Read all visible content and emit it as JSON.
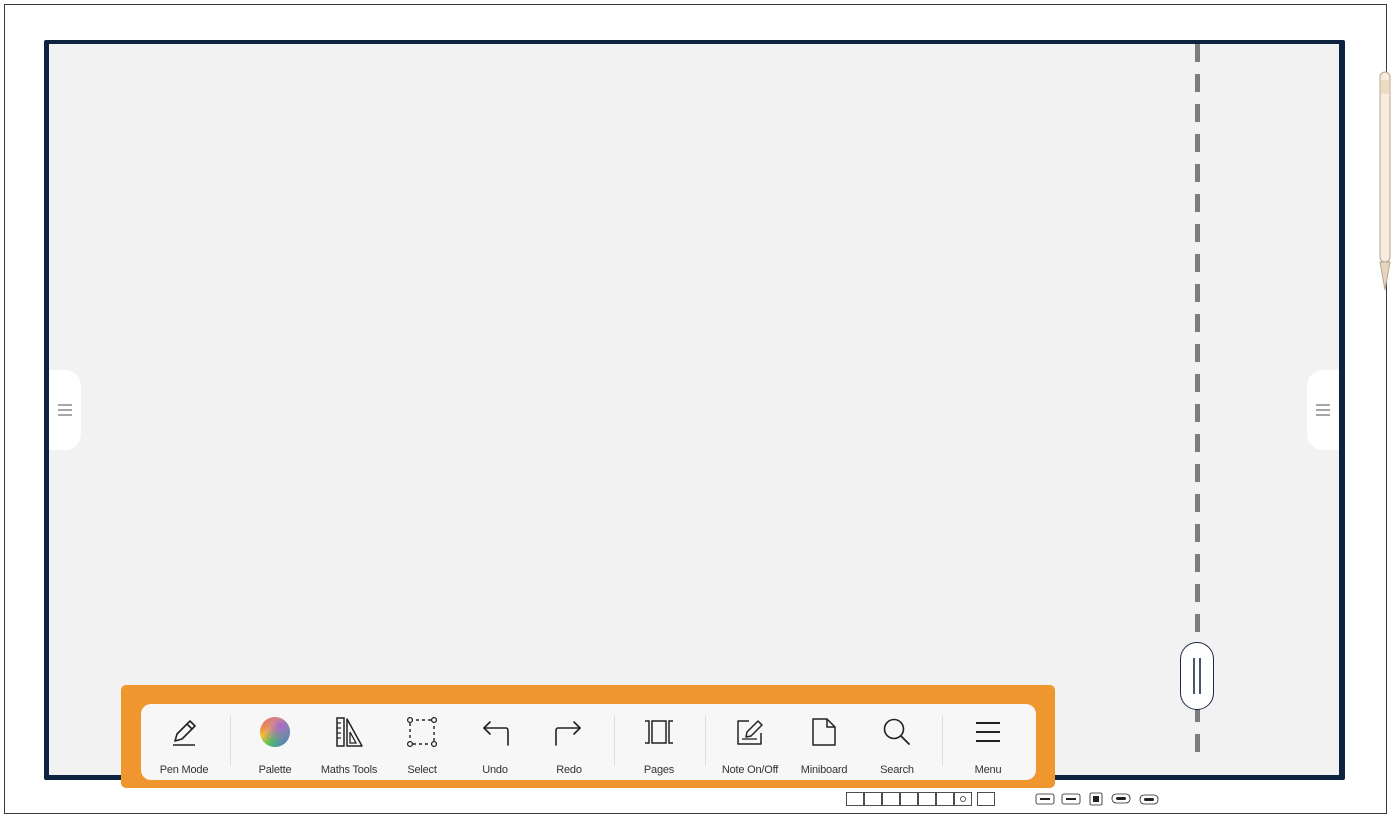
{
  "toolbar": {
    "tools": [
      {
        "id": "pen-mode",
        "label": "Pen Mode",
        "icon": "pen-icon"
      },
      {
        "id": "palette",
        "label": "Palette",
        "icon": "color-wheel-icon"
      },
      {
        "id": "maths-tools",
        "label": "Maths Tools",
        "icon": "ruler-triangle-icon"
      },
      {
        "id": "select",
        "label": "Select",
        "icon": "selection-icon"
      },
      {
        "id": "undo",
        "label": "Undo",
        "icon": "undo-arrow-icon"
      },
      {
        "id": "redo",
        "label": "Redo",
        "icon": "redo-arrow-icon"
      },
      {
        "id": "pages",
        "label": "Pages",
        "icon": "pages-icon"
      },
      {
        "id": "note-on-off",
        "label": "Note On/Off",
        "icon": "note-edit-icon"
      },
      {
        "id": "miniboard",
        "label": "Miniboard",
        "icon": "document-icon"
      },
      {
        "id": "search",
        "label": "Search",
        "icon": "search-icon"
      },
      {
        "id": "menu",
        "label": "Menu",
        "icon": "hamburger-menu-icon"
      }
    ]
  },
  "side_tabs": {
    "left_icon": "side-menu-icon",
    "right_icon": "side-menu-icon"
  },
  "colors": {
    "bezel": "#0e2340",
    "canvas": "#f2f2f2",
    "highlight": "#f0962e",
    "toolbar_bg": "#f7f7f7",
    "divider": "#7d7d7d"
  }
}
